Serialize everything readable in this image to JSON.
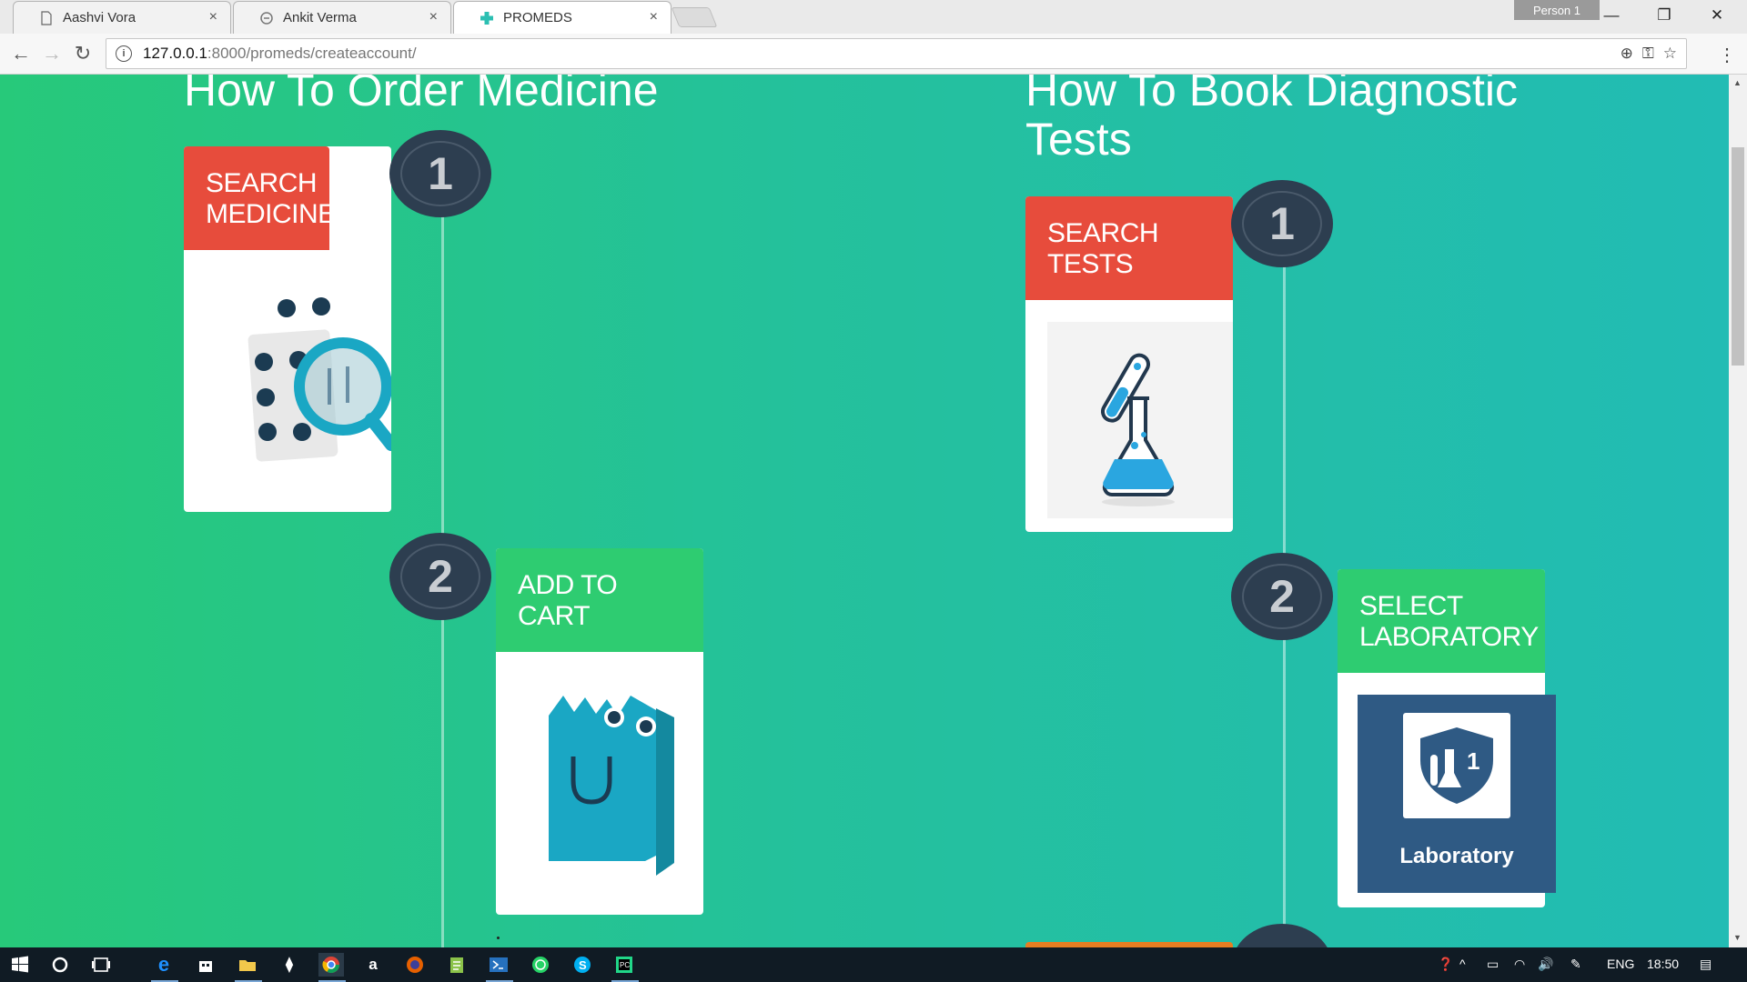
{
  "browser": {
    "tabs": [
      {
        "label": "Aashvi Vora",
        "close": "×",
        "icon": "document-icon"
      },
      {
        "label": "Ankit Verma",
        "close": "×",
        "icon": "loading-icon"
      },
      {
        "label": "PROMEDS",
        "close": "×",
        "icon": "medical-cross-icon",
        "active": true
      }
    ],
    "person": "Person 1",
    "url_host": "127.0.0.1",
    "url_rest": ":8000/promeds/createaccount/",
    "window_controls": {
      "minimize": "—",
      "restore": "❐",
      "close": "✕"
    }
  },
  "page": {
    "medicine_section": {
      "title": "How To Order Medicine",
      "steps": [
        {
          "number": "1",
          "label": "SEARCH MEDICINE",
          "color": "#e74c3c"
        },
        {
          "number": "2",
          "label": "ADD TO CART",
          "color": "#2ecc71"
        }
      ]
    },
    "tests_section": {
      "title_line1": "How To Book Diagnostic",
      "title_line2": "Tests",
      "steps": [
        {
          "number": "1",
          "label": "SEARCH TESTS",
          "color": "#e74c3c"
        },
        {
          "number": "2",
          "label": "SELECT LABORATORY",
          "color": "#2ecc71",
          "image_caption": "Laboratory"
        }
      ]
    }
  },
  "taskbar": {
    "language": "ENG",
    "time": "18:50"
  },
  "colors": {
    "background_start": "#27c97a",
    "background_end": "#22bcb4",
    "step_circle": "#2d3e50",
    "red": "#e74c3c",
    "green": "#2ecc71",
    "lab_blue": "#2f5a84"
  }
}
